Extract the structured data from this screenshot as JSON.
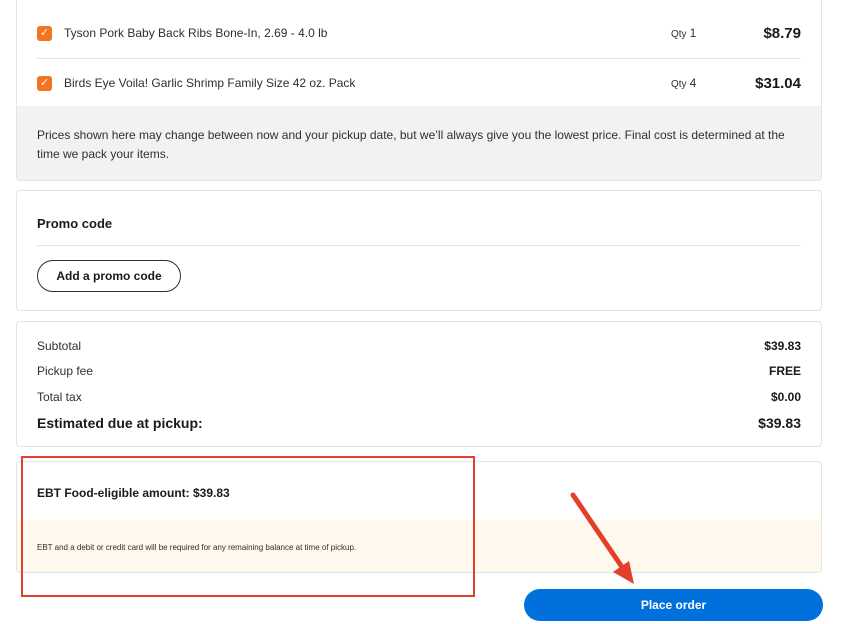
{
  "items": [
    {
      "name": "Tyson Pork Baby Back Ribs Bone-In, 2.69 - 4.0 lb",
      "qty_label": "Qty",
      "qty": "1",
      "price": "$8.79"
    },
    {
      "name": "Birds Eye Voila! Garlic Shrimp Family Size 42 oz. Pack",
      "qty_label": "Qty",
      "qty": "4",
      "price": "$31.04"
    }
  ],
  "disclaimer": "Prices shown here may change between now and your pickup date, but we’ll always give you the lowest price. Final cost is determined at the time we pack your items.",
  "promo": {
    "title": "Promo code",
    "button_label": "Add a promo code"
  },
  "summary": {
    "subtotal_label": "Subtotal",
    "subtotal": "$39.83",
    "pickup_fee_label": "Pickup fee",
    "pickup_fee": "FREE",
    "tax_label": "Total tax",
    "tax": "$0.00",
    "estimated_label": "Estimated due at pickup:",
    "estimated": "$39.83"
  },
  "ebt": {
    "title": "EBT Food-eligible amount: $39.83",
    "note": "EBT and a debit or credit card will be required for any remaining balance at time of pickup."
  },
  "place_order_label": "Place order",
  "colors": {
    "checkbox": "#f47321",
    "primary": "#0071dc",
    "annotation": "#e2402b",
    "ebt_note_bg": "#fff8ec"
  }
}
